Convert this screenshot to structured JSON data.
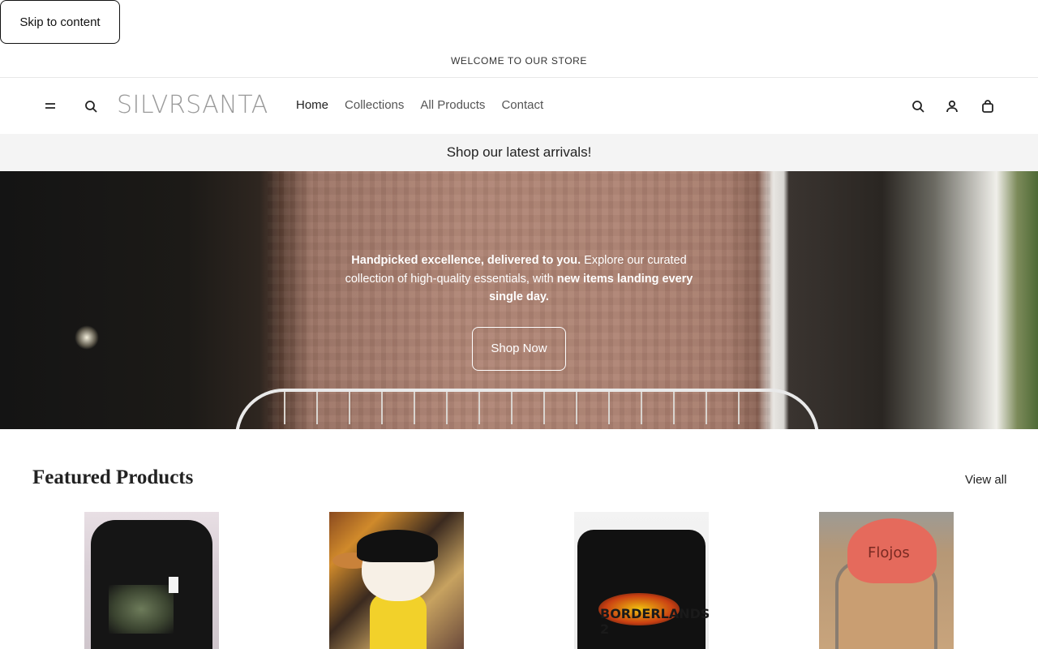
{
  "skip_link": {
    "label": "Skip to content"
  },
  "announcement": {
    "text": "WELCOME TO OUR STORE"
  },
  "header": {
    "logo": "SILVRSANTA",
    "nav": [
      {
        "label": "Home",
        "active": true
      },
      {
        "label": "Collections",
        "active": false
      },
      {
        "label": "All Products",
        "active": false
      },
      {
        "label": "Contact",
        "active": false
      }
    ],
    "icons": [
      "menu-icon",
      "search-icon",
      "search-icon",
      "account-icon",
      "cart-icon"
    ]
  },
  "promo": {
    "text": "Shop our latest arrivals!"
  },
  "hero": {
    "text_bold_1": "Handpicked excellence, delivered to you.",
    "text_regular": " Explore our curated collection of high-quality essentials, with ",
    "text_bold_2": "new items landing every single day.",
    "button_label": "Shop Now"
  },
  "featured": {
    "title": "Featured Products",
    "view_all": "View all",
    "products": [
      {
        "image": "black-zip-hoodie"
      },
      {
        "image": "betty-boop-waitress-figure"
      },
      {
        "image": "borderlands-2-tshirt"
      },
      {
        "image": "flojos-sandals",
        "brand_text": "Flojos"
      }
    ],
    "shirt_print": "BORDERLANDS 2"
  }
}
